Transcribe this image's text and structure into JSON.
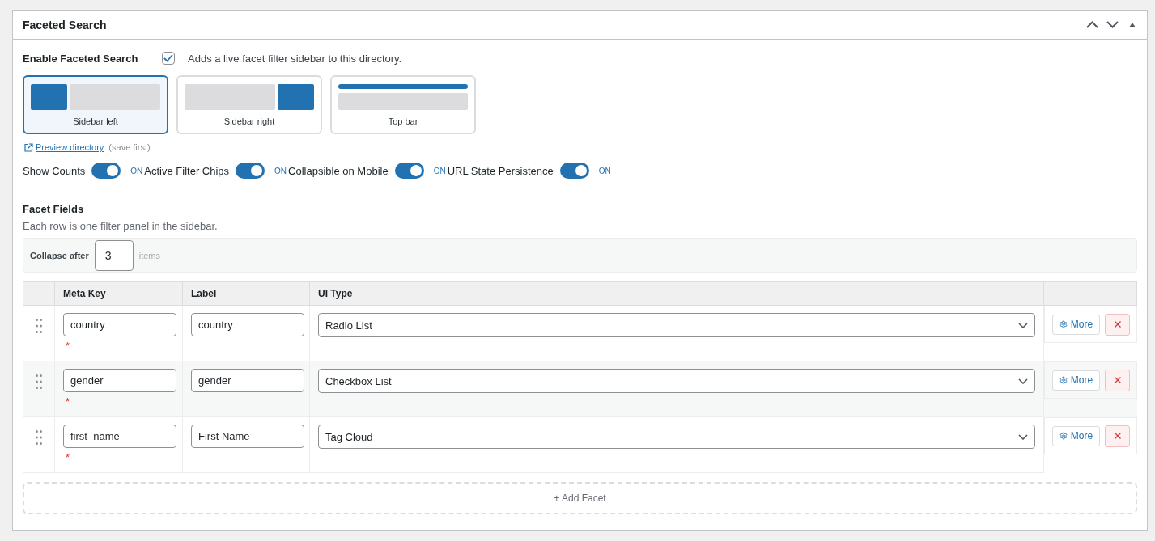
{
  "panel": {
    "title": "Faceted Search"
  },
  "enable": {
    "label": "Enable Faceted Search",
    "checked": true,
    "description": "Adds a live facet filter sidebar to this directory."
  },
  "layouts": [
    {
      "label": "Sidebar left",
      "kind": "sidebar-left",
      "selected": true
    },
    {
      "label": "Sidebar right",
      "kind": "sidebar-right",
      "selected": false
    },
    {
      "label": "Top bar",
      "kind": "top-bar",
      "selected": false
    }
  ],
  "preview": {
    "link": "Preview directory",
    "note": "(save first)"
  },
  "toggles": [
    {
      "label": "Show Counts",
      "on": true,
      "state_text": "ON"
    },
    {
      "label": "Active Filter Chips",
      "on": true,
      "state_text": "ON"
    },
    {
      "label": "Collapsible on Mobile",
      "on": true,
      "state_text": "ON"
    },
    {
      "label": "URL State Persistence",
      "on": true,
      "state_text": "ON"
    }
  ],
  "facet_fields": {
    "title": "Facet Fields",
    "description": "Each row is one filter panel in the sidebar.",
    "collapse": {
      "label": "Collapse after",
      "value": "3",
      "unit": "items"
    },
    "columns": [
      "Meta Key",
      "Label",
      "UI Type"
    ],
    "rows": [
      {
        "meta_key": "country",
        "required_mark": "*",
        "label": "country",
        "ui_type": "Radio List",
        "more": "More"
      },
      {
        "meta_key": "gender",
        "required_mark": "*",
        "label": "gender",
        "ui_type": "Checkbox List",
        "more": "More"
      },
      {
        "meta_key": "first_name",
        "required_mark": "*",
        "label": "First Name",
        "ui_type": "Tag Cloud",
        "more": "More"
      }
    ],
    "add_button": "+ Add Facet"
  }
}
